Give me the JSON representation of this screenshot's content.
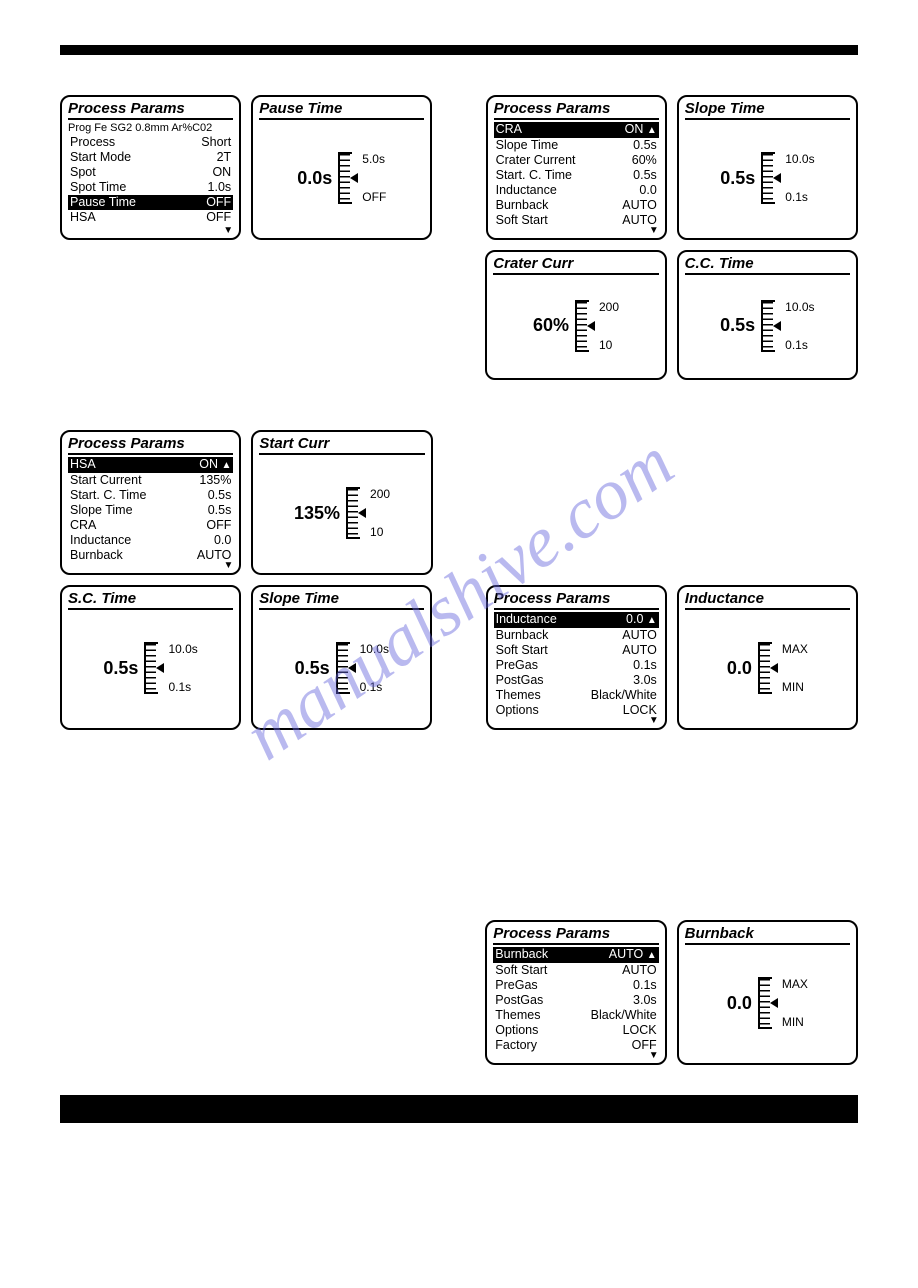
{
  "watermark": "manualshive.com",
  "panels": {
    "r1p1": {
      "title": "Process Params",
      "sub": "Prog Fe SG2 0.8mm Ar%C02",
      "rows": [
        [
          "Process",
          "Short"
        ],
        [
          "Start Mode",
          "2T"
        ],
        [
          "Spot",
          "ON"
        ],
        [
          " Spot Time",
          "1.0s"
        ],
        [
          " Pause Time",
          "OFF",
          "sel"
        ],
        [
          "HSA",
          "OFF"
        ]
      ],
      "down": true
    },
    "r1p2": {
      "title": "Pause Time",
      "value": "0.0s",
      "hi": "5.0s",
      "lo": "OFF"
    },
    "r1p3": {
      "title": "Process Params",
      "rows": [
        [
          "CRA",
          "ON",
          "sel",
          "up"
        ],
        [
          " Slope Time",
          "0.5s"
        ],
        [
          " Crater Current",
          "60%"
        ],
        [
          " Start. C. Time",
          "0.5s"
        ],
        [
          "Inductance",
          "0.0"
        ],
        [
          "Burnback",
          "AUTO"
        ],
        [
          "Soft Start",
          "AUTO"
        ]
      ],
      "down": true
    },
    "r1p4": {
      "title": "Slope Time",
      "value": "0.5s",
      "hi": "10.0s",
      "lo": "0.1s"
    },
    "r2p3": {
      "title": "Crater Curr",
      "value": "60%",
      "hi": "200",
      "lo": "10"
    },
    "r2p4": {
      "title": "C.C. Time",
      "value": "0.5s",
      "hi": "10.0s",
      "lo": "0.1s"
    },
    "r3p1": {
      "title": "Process Params",
      "rows": [
        [
          "HSA",
          "ON",
          "sel",
          "up"
        ],
        [
          " Start Current",
          "135%"
        ],
        [
          " Start. C. Time",
          "0.5s"
        ],
        [
          " Slope Time",
          "0.5s"
        ],
        [
          "CRA",
          "OFF"
        ],
        [
          "Inductance",
          "0.0"
        ],
        [
          "Burnback",
          "AUTO"
        ]
      ],
      "down": true
    },
    "r3p2": {
      "title": "Start Curr",
      "value": "135%",
      "hi": "200",
      "lo": "10"
    },
    "r4p1": {
      "title": "S.C. Time",
      "value": "0.5s",
      "hi": "10.0s",
      "lo": "0.1s"
    },
    "r4p2": {
      "title": "Slope Time",
      "value": "0.5s",
      "hi": "10.0s",
      "lo": "0.1s"
    },
    "r4p3": {
      "title": "Process Params",
      "rows": [
        [
          "Inductance",
          "0.0",
          "sel",
          "up"
        ],
        [
          "Burnback",
          "AUTO"
        ],
        [
          "Soft Start",
          "AUTO"
        ],
        [
          "PreGas",
          "0.1s"
        ],
        [
          "PostGas",
          "3.0s"
        ],
        [
          "Themes",
          "Black/White"
        ],
        [
          "Options",
          "LOCK"
        ]
      ],
      "down": true
    },
    "r4p4": {
      "title": "Inductance",
      "value": "0.0",
      "hi": "MAX",
      "lo": "MIN"
    },
    "r5p3": {
      "title": "Process Params",
      "rows": [
        [
          " Burnback",
          "AUTO",
          "sel",
          "up"
        ],
        [
          "Soft Start",
          "AUTO"
        ],
        [
          "PreGas",
          "0.1s"
        ],
        [
          "PostGas",
          "3.0s"
        ],
        [
          "Themes",
          "Black/White"
        ],
        [
          "Options",
          "LOCK"
        ],
        [
          "Factory",
          "OFF"
        ]
      ],
      "down": true
    },
    "r5p4": {
      "title": "Burnback",
      "value": "0.0",
      "hi": "MAX",
      "lo": "MIN"
    }
  }
}
